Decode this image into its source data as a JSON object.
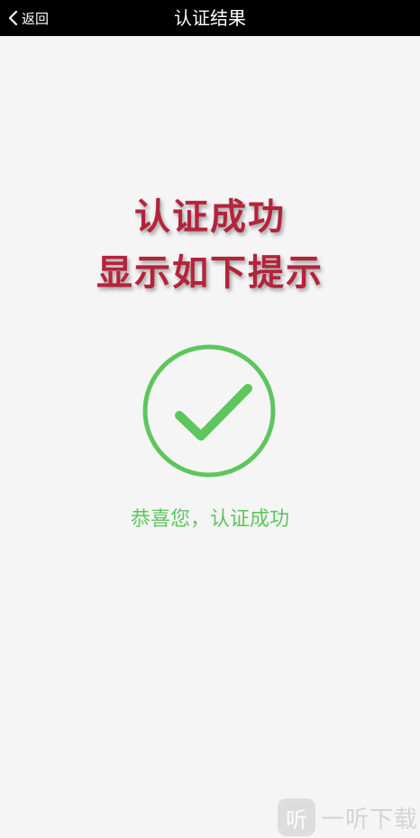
{
  "header": {
    "back_label": "返回",
    "title": "认证结果"
  },
  "overlay": {
    "line1": "认证成功",
    "line2": "显示如下提示",
    "color": "#b3243a"
  },
  "result": {
    "icon": "checkmark-circle-icon",
    "message": "恭喜您，认证成功",
    "color": "#5dc65d"
  },
  "watermark": {
    "text": "一听下载",
    "logo_text": "听"
  }
}
